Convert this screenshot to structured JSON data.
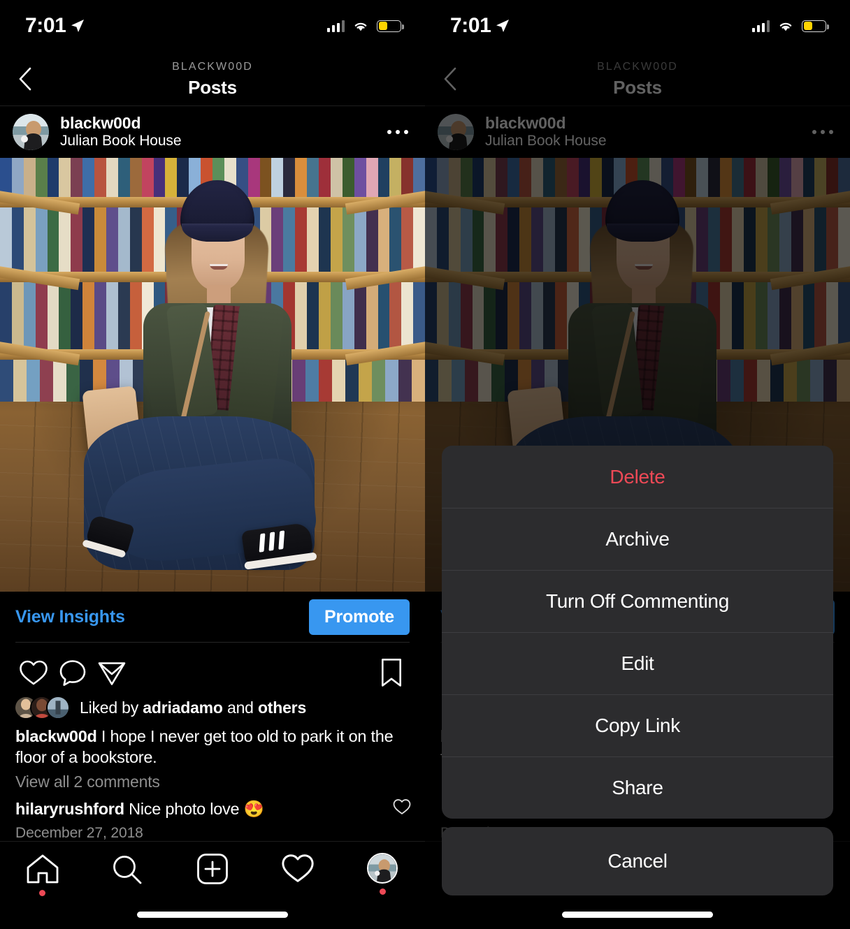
{
  "status_bar": {
    "time": "7:01",
    "location_icon": "location-arrow-icon",
    "cellular_icon": "cellular-bars-icon",
    "wifi_icon": "wifi-icon",
    "battery_icon": "battery-low-power-icon",
    "battery_color": "#ffd400"
  },
  "nav": {
    "back_icon": "chevron-left-icon",
    "subtitle": "BLACKW00D",
    "title": "Posts"
  },
  "post": {
    "avatar": "user-avatar",
    "username": "blackw00d",
    "location": "Julian Book House",
    "more_icon": "more-options-icon",
    "photo_alt": "woman-sitting-on-bookstore-floor-photo"
  },
  "actions": {
    "view_insights": "View Insights",
    "promote": "Promote",
    "promote_color": "#3897f0",
    "link_color": "#3897f0",
    "like_icon": "heart-icon",
    "comment_icon": "comment-bubble-icon",
    "share_icon": "paper-plane-icon",
    "save_icon": "bookmark-icon"
  },
  "engagement": {
    "liked_by_prefix": "Liked by ",
    "liked_by_user": "adriadamo",
    "liked_by_middle": " and ",
    "liked_by_suffix": "others",
    "caption_user": "blackw00d",
    "caption_text": " I hope I never get too old to park it on the floor of a bookstore.",
    "view_all_comments": "View all 2 comments",
    "comment_user": "hilaryrushford",
    "comment_text": " Nice photo love ",
    "comment_emoji": "😍",
    "comment_like_icon": "heart-outline-icon",
    "date": "December 27, 2018"
  },
  "tabbar": {
    "items": [
      {
        "name": "home",
        "icon": "home-icon",
        "badge": true
      },
      {
        "name": "search",
        "icon": "search-icon",
        "badge": false
      },
      {
        "name": "create",
        "icon": "plus-square-icon",
        "badge": false
      },
      {
        "name": "activity",
        "icon": "heart-icon",
        "badge": false
      },
      {
        "name": "profile",
        "icon": "profile-avatar-icon",
        "badge": true
      }
    ],
    "badge_color": "#ed4956"
  },
  "action_sheet": {
    "items": [
      {
        "label": "Delete",
        "style": "destructive"
      },
      {
        "label": "Archive",
        "style": "default"
      },
      {
        "label": "Turn Off Commenting",
        "style": "default"
      },
      {
        "label": "Edit",
        "style": "default"
      },
      {
        "label": "Copy Link",
        "style": "default"
      },
      {
        "label": "Share",
        "style": "default"
      }
    ],
    "cancel": "Cancel",
    "destructive_color": "#ed4956",
    "sheet_bg": "#2c2c2e"
  }
}
